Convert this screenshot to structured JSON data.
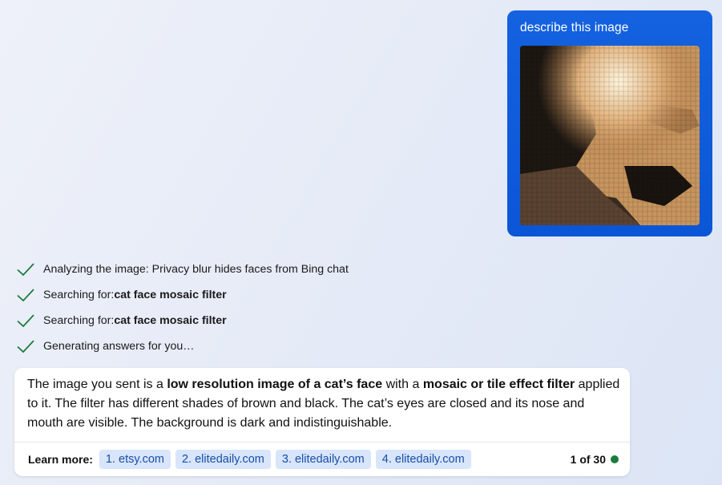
{
  "user_message": {
    "text": "describe this image",
    "image_alt": "cat face mosaic image"
  },
  "steps": [
    {
      "prefix": "Analyzing the image: Privacy blur hides faces from Bing chat",
      "bold": ""
    },
    {
      "prefix": "Searching for: ",
      "bold": "cat face mosaic filter"
    },
    {
      "prefix": "Searching for: ",
      "bold": "cat face mosaic filter"
    },
    {
      "prefix": "Generating answers for you…",
      "bold": ""
    }
  ],
  "answer": {
    "part1": "The image you sent is a ",
    "bold1": "low resolution image of a cat’s face",
    "part2": " with a ",
    "bold2": "mosaic or tile effect filter",
    "part3": " applied to it. The filter has different shades of brown and black. The cat’s eyes are closed and its nose and mouth are visible. The background is dark and indistinguishable."
  },
  "footer": {
    "learn_more_label": "Learn more:",
    "sources": [
      "1. etsy.com",
      "2. elitedaily.com",
      "3. elitedaily.com",
      "4. elitedaily.com"
    ],
    "page_count": "1 of 30"
  },
  "colors": {
    "user_bubble": "#0b56d6",
    "check": "#1e7b3e",
    "chip_bg": "#d8e5fb",
    "chip_text": "#174ea6",
    "status_dot": "#1e7b3e"
  }
}
